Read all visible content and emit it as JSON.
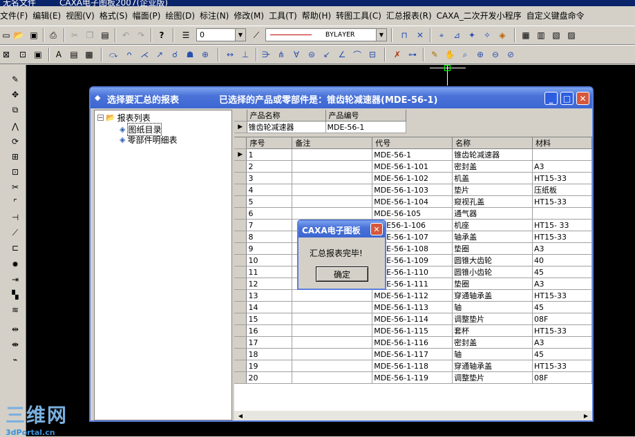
{
  "app": {
    "title": "CAXA电子图板2007(企业版)",
    "title_prefix": "无名文件"
  },
  "menu": [
    "文件(F)",
    "编辑(E)",
    "视图(V)",
    "格式(S)",
    "幅面(P)",
    "绘图(D)",
    "标注(N)",
    "修改(M)",
    "工具(T)",
    "帮助(H)",
    "转图工具(C)",
    "汇总报表(R)",
    "CAXA_二次开发小程序",
    "自定义键盘命令"
  ],
  "toolbar": {
    "layer_value": "0",
    "linetype_value": "BYLAYER"
  },
  "dialog": {
    "title": "选择要汇总的报表",
    "subtitle": "已选择的产品或零部件是：锥齿轮减速器(MDE-56-1)",
    "tree": {
      "root": "报表列表",
      "children": [
        "图纸目录",
        "零部件明细表"
      ]
    },
    "product_grid": {
      "headers": [
        "产品名称",
        "产品编号"
      ],
      "row": [
        "锥齿轮减速器",
        "MDE-56-1"
      ]
    },
    "parts_grid": {
      "headers": [
        "序号",
        "备注",
        "代号",
        "名称",
        "材料"
      ],
      "rows": [
        [
          "1",
          "",
          "MDE-56-1",
          "锥齿轮减速器",
          ""
        ],
        [
          "2",
          "",
          "MDE-56-1-101",
          "密封盖",
          "A3"
        ],
        [
          "3",
          "",
          "MDE-56-1-102",
          "机盖",
          "HT15-33"
        ],
        [
          "4",
          "",
          "MDE-56-1-103",
          "垫片",
          "压纸板"
        ],
        [
          "5",
          "",
          "MDE-56-1-104",
          "窥视孔盖",
          "HT15-33"
        ],
        [
          "6",
          "",
          "MDE-56-105",
          "通气器",
          ""
        ],
        [
          "7",
          "",
          "MDE56-1-106",
          "机座",
          "HT15- 33"
        ],
        [
          "8",
          "",
          "MDE-56-1-107",
          "轴承盖",
          "HT15-33"
        ],
        [
          "9",
          "",
          "MDE-56-1-108",
          "垫圈",
          "A3"
        ],
        [
          "10",
          "",
          "MDE-56-1-109",
          "圆锥大齿轮",
          "40"
        ],
        [
          "11",
          "",
          "MDE-56-1-110",
          "圆锥小齿轮",
          "45"
        ],
        [
          "12",
          "",
          "MDE-56-1-111",
          "垫圈",
          "A3"
        ],
        [
          "13",
          "",
          "MDE-56-1-112",
          "穿通轴承盖",
          "HT15-33"
        ],
        [
          "14",
          "",
          "MDE-56-1-113",
          "轴",
          "45"
        ],
        [
          "15",
          "",
          "MDE-56-1-114",
          "调整垫片",
          "08F"
        ],
        [
          "16",
          "",
          "MDE-56-1-115",
          "套杯",
          "HT15-33"
        ],
        [
          "17",
          "",
          "MDE-56-1-116",
          "密封盖",
          "A3"
        ],
        [
          "18",
          "",
          "MDE-56-1-117",
          "轴",
          "45"
        ],
        [
          "19",
          "",
          "MDE-56-1-118",
          "穿通轴承盖",
          "HT15-33"
        ],
        [
          "20",
          "",
          "MDE-56-1-119",
          "调整垫片",
          "08F"
        ]
      ]
    }
  },
  "msgbox": {
    "title": "CAXA电子图板",
    "text": "汇总报表完毕!",
    "ok": "确定"
  },
  "watermark": {
    "big": "三维网",
    "small": "3dPortal.cn"
  }
}
